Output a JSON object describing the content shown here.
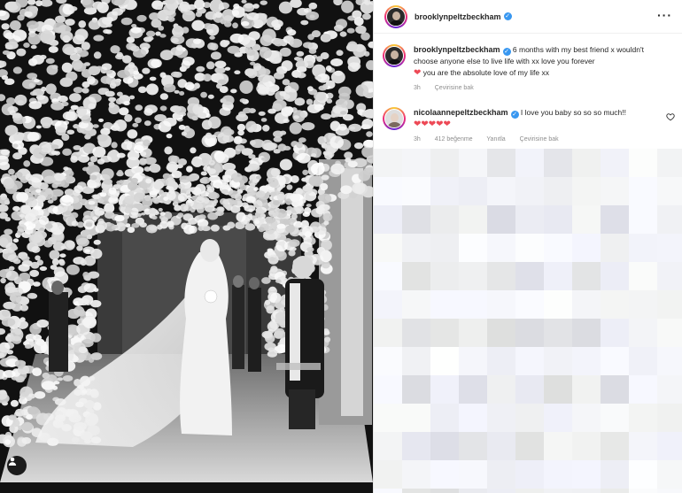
{
  "post_author": {
    "username": "brooklynpeltzbeckham",
    "verified": true
  },
  "caption": {
    "username": "brooklynpeltzbeckham",
    "line1": "6 months with my best friend x wouldn't choose anyone else to live life with xx love you forever",
    "line2": "you are the absolute love of my life xx",
    "time": "3h",
    "translate_label": "Çevirisine bak"
  },
  "reply": {
    "username": "nicolaannepeltzbeckham",
    "text": "I love you baby so so so much!!",
    "hearts": "❤❤❤❤❤",
    "time": "3h",
    "likes_label": "412 beğenme",
    "reply_label": "Yanıtla",
    "translate_label": "Çevirisine bak"
  },
  "colors": {
    "verified_blue": "#3897f0",
    "heart_red": "#ed4956",
    "meta_gray": "#8e8e8e"
  },
  "icons": {
    "more": "more-horizontal-icon",
    "user_tag": "user-tag-icon",
    "like": "heart-outline-icon"
  }
}
